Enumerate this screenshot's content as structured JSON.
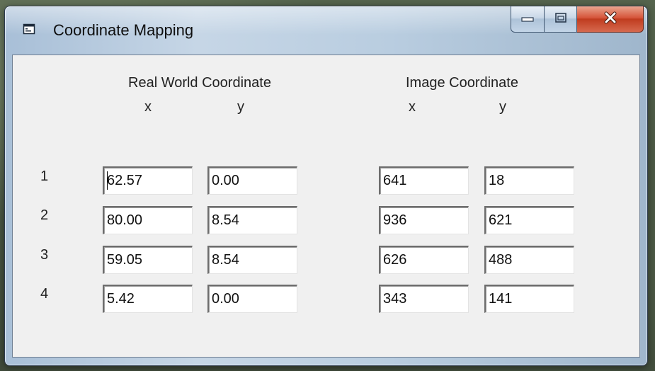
{
  "window": {
    "title": "Coordinate Mapping"
  },
  "headers": {
    "real_world": "Real World Coordinate",
    "image": "Image Coordinate",
    "real_x": "x",
    "real_y": "y",
    "image_x": "x",
    "image_y": "y"
  },
  "rows": [
    {
      "label": "1",
      "real_x": "62.57",
      "real_y": "0.00",
      "image_x": "641",
      "image_y": "18"
    },
    {
      "label": "2",
      "real_x": "80.00",
      "real_y": "8.54",
      "image_x": "936",
      "image_y": "621"
    },
    {
      "label": "3",
      "real_x": "59.05",
      "real_y": "8.54",
      "image_x": "626",
      "image_y": "488"
    },
    {
      "label": "4",
      "real_x": "5.42",
      "real_y": "0.00",
      "image_x": "343",
      "image_y": "141"
    }
  ],
  "icons": {
    "app": "form-icon",
    "minimize": "minimize-icon",
    "maximize": "maximize-icon",
    "close": "close-icon"
  },
  "colors": {
    "close_button": "#c9442a",
    "client_background": "#f0f0f0"
  }
}
